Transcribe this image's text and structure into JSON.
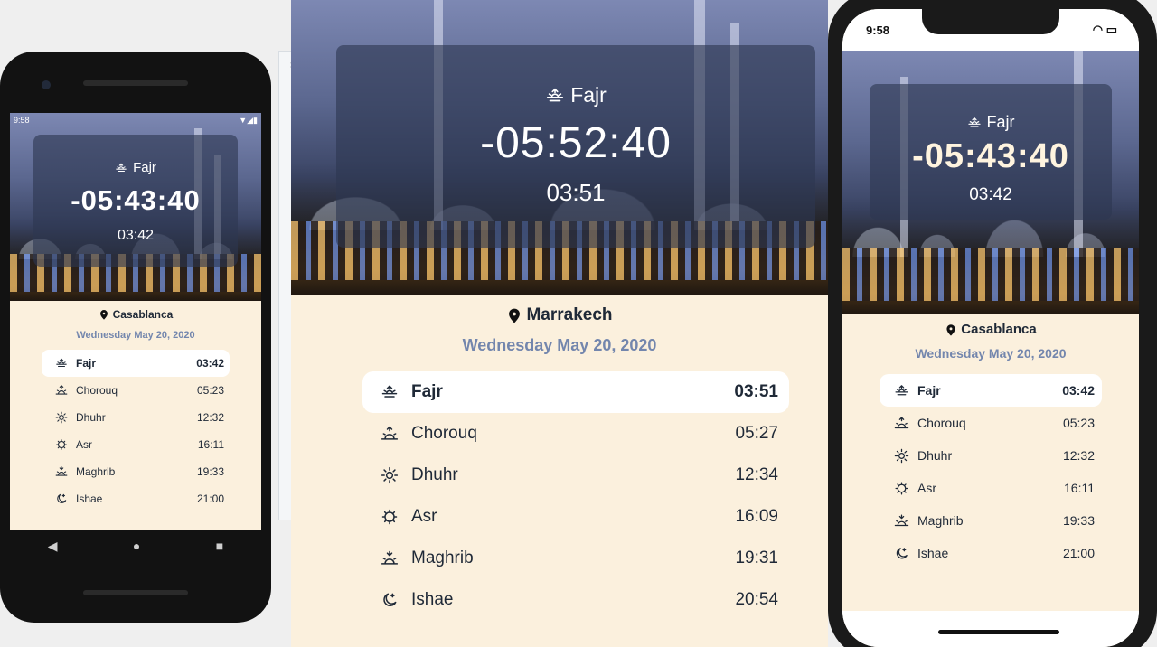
{
  "android": {
    "status_time": "9:58",
    "hero": {
      "name": "Fajr",
      "countdown": "-05:43:40",
      "time": "03:42"
    },
    "city": "Casablanca",
    "date": "Wednesday May 20, 2020",
    "prayers": [
      {
        "name": "Fajr",
        "time": "03:42",
        "icon": "fajr-icon"
      },
      {
        "name": "Chorouq",
        "time": "05:23",
        "icon": "sunrise-icon"
      },
      {
        "name": "Dhuhr",
        "time": "12:32",
        "icon": "sun-icon"
      },
      {
        "name": "Asr",
        "time": "16:11",
        "icon": "sun-outline-icon"
      },
      {
        "name": "Maghrib",
        "time": "19:33",
        "icon": "sunset-icon"
      },
      {
        "name": "Ishae",
        "time": "21:00",
        "icon": "moon-icon"
      }
    ]
  },
  "toolbar": {
    "close": "×",
    "minimize": "–",
    "buttons": [
      "power-icon",
      "volume-up-icon",
      "volume-down-icon",
      "rotate-left-icon",
      "rotate-right-icon",
      "camera-icon",
      "zoom-icon",
      "back-icon",
      "home-icon",
      "overview-icon",
      "more-icon"
    ]
  },
  "web": {
    "hero": {
      "name": "Fajr",
      "countdown": "-05:52:40",
      "time": "03:51"
    },
    "city": "Marrakech",
    "date": "Wednesday May 20, 2020",
    "prayers": [
      {
        "name": "Fajr",
        "time": "03:51",
        "icon": "fajr-icon"
      },
      {
        "name": "Chorouq",
        "time": "05:27",
        "icon": "sunrise-icon"
      },
      {
        "name": "Dhuhr",
        "time": "12:34",
        "icon": "sun-icon"
      },
      {
        "name": "Asr",
        "time": "16:09",
        "icon": "sun-outline-icon"
      },
      {
        "name": "Maghrib",
        "time": "19:31",
        "icon": "sunset-icon"
      },
      {
        "name": "Ishae",
        "time": "20:54",
        "icon": "moon-icon"
      }
    ]
  },
  "iphone": {
    "status_time": "9:58",
    "hero": {
      "name": "Fajr",
      "countdown": "-05:43:40",
      "time": "03:42"
    },
    "city": "Casablanca",
    "date": "Wednesday May 20, 2020",
    "prayers": [
      {
        "name": "Fajr",
        "time": "03:42",
        "icon": "fajr-icon"
      },
      {
        "name": "Chorouq",
        "time": "05:23",
        "icon": "sunrise-icon"
      },
      {
        "name": "Dhuhr",
        "time": "12:32",
        "icon": "sun-icon"
      },
      {
        "name": "Asr",
        "time": "16:11",
        "icon": "sun-outline-icon"
      },
      {
        "name": "Maghrib",
        "time": "19:33",
        "icon": "sunset-icon"
      },
      {
        "name": "Ishae",
        "time": "21:00",
        "icon": "moon-icon"
      }
    ]
  },
  "colors": {
    "accent_date": "#7386ad",
    "pane_bg": "#fbf0dd",
    "text_dark": "#1f2937"
  }
}
